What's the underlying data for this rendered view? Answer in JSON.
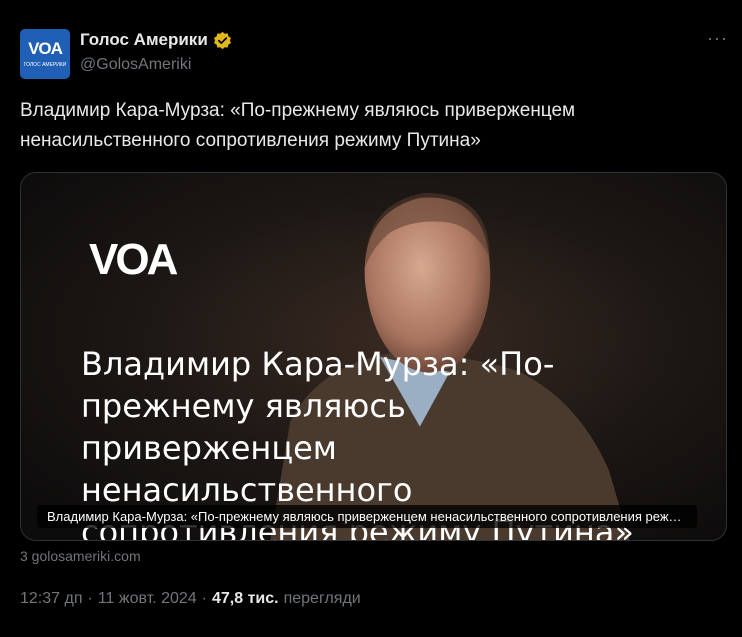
{
  "account": {
    "name": "Голос Америки",
    "handle": "@GolosAmeriki",
    "avatar_text": "VOA",
    "avatar_sub": "ГОЛОС АМЕРИКИ",
    "verified_color": "#e2b719"
  },
  "more_label": "···",
  "tweet": {
    "text": "Владимир Кара-Мурза: «По-прежнему являюсь приверженцем ненасильственного сопротивления режиму Путина»"
  },
  "card": {
    "logo_text": "VOA",
    "headline": "Владимир Кара-Мурза: «По-прежнему являюсь приверженцем ненасильственного сопротивления режиму Путина»",
    "caption": "Владимир Кара-Мурза: «По-прежнему являюсь приверженцем ненасильственного сопротивления режиму Путина»"
  },
  "link_domain": "3 golosameriki.com",
  "meta": {
    "time": "12:37 дп",
    "date": "11 жовт. 2024",
    "separator": "·",
    "views_count": "47,8 тис.",
    "views_label": "перегляди"
  }
}
